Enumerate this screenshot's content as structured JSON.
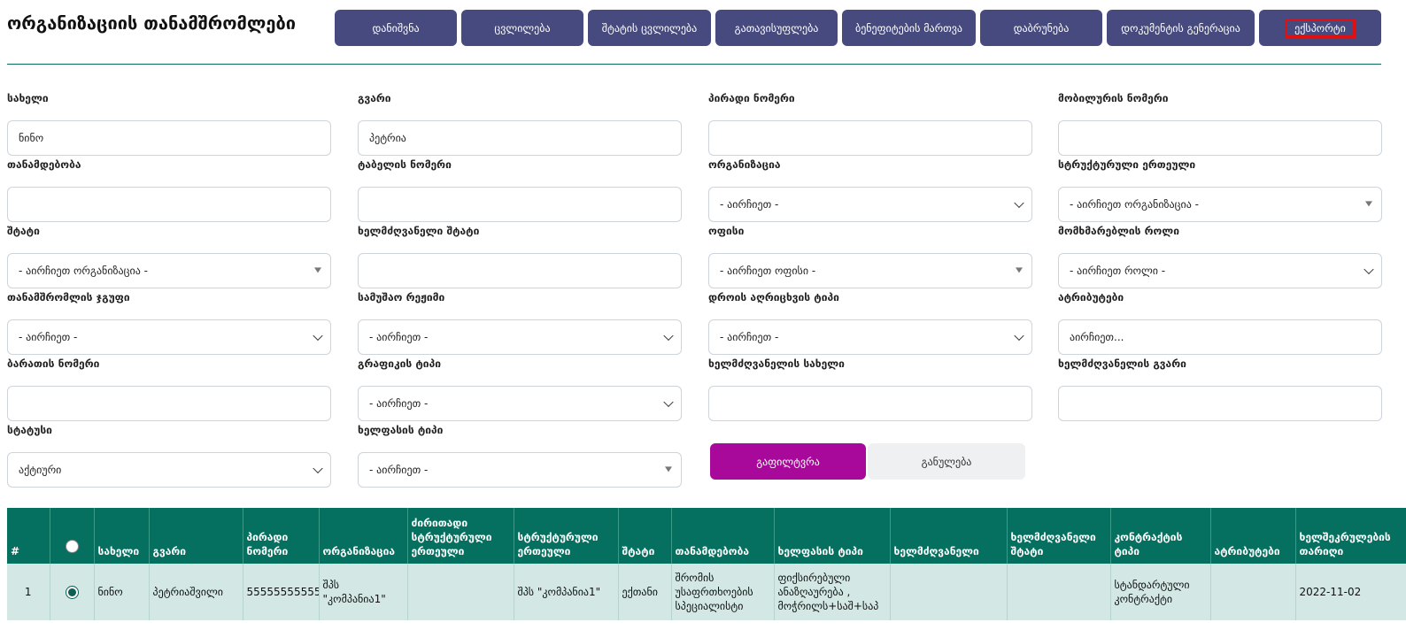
{
  "page": {
    "title": "ორგანიზაციის თანამშრომლები"
  },
  "actions": [
    {
      "label": "დანიშვნა"
    },
    {
      "label": "ცვლილება"
    },
    {
      "label": "შტატის ცვლილება"
    },
    {
      "label": "გათავისუფლება"
    },
    {
      "label": "ბენეფიტების მართვა"
    },
    {
      "label": "დაბრუნება"
    },
    {
      "label": "დოკუმენტის გენერაცია"
    },
    {
      "label": "ექსპორტი"
    }
  ],
  "filters": {
    "first_name": {
      "label": "სახელი",
      "value": "ნინო"
    },
    "last_name": {
      "label": "გვარი",
      "value": "პეტრია"
    },
    "personal_number": {
      "label": "პირადი ნომერი",
      "value": ""
    },
    "mobile_number": {
      "label": "მობილურის ნომერი",
      "value": ""
    },
    "position": {
      "label": "თანამდებობა",
      "value": ""
    },
    "table_number": {
      "label": "ტაბელის ნომერი",
      "value": ""
    },
    "organization": {
      "label": "ორგანიზაცია",
      "value": "- აირჩიეთ -"
    },
    "structural_unit": {
      "label": "სტრუქტურული ერთეული",
      "value": "- აირჩიეთ ორგანიზაცია -"
    },
    "staff": {
      "label": "შტატი",
      "value": "- აირჩიეთ ორგანიზაცია -"
    },
    "manager_staff": {
      "label": "ხელმძღვანელი შტატი",
      "value": ""
    },
    "office": {
      "label": "ოფისი",
      "value": "- აირჩიეთ ოფისი -"
    },
    "user_role": {
      "label": "მომხმარებლის როლი",
      "value": "- აირჩიეთ როლი -"
    },
    "employee_group": {
      "label": "თანამშრომლის ჯგუფი",
      "value": "- აირჩიეთ -"
    },
    "work_mode": {
      "label": "სამუშაო რეჟიმი",
      "value": "- აირჩიეთ -"
    },
    "time_tracking_type": {
      "label": "დროის აღრიცხვის ტიპი",
      "value": "- აირჩიეთ -"
    },
    "attributes": {
      "label": "ატრიბუტები",
      "value": "აირჩიეთ..."
    },
    "card_number": {
      "label": "ბარათის ნომერი",
      "value": ""
    },
    "schedule_type": {
      "label": "გრაფიკის ტიპი",
      "value": "- აირჩიეთ -"
    },
    "manager_first_name": {
      "label": "ხელმძღვანელის სახელი",
      "value": ""
    },
    "manager_last_name": {
      "label": "ხელმძღვანელის გვარი",
      "value": ""
    },
    "status": {
      "label": "სტატუსი",
      "value": "აქტიური"
    },
    "salary_type": {
      "label": "ხელფასის ტიპი",
      "value": "- აირჩიეთ -"
    }
  },
  "buttons": {
    "filter": "გაფილტვრა",
    "reset": "განულება"
  },
  "table": {
    "headers": {
      "num": "#",
      "first_name": "სახელი",
      "last_name": "გვარი",
      "personal_number": "პირადი ნომერი",
      "organization": "ორგანიზაცია",
      "main_structural_unit": "ძირითადი სტრუქტურული ერთეული",
      "structural_unit": "სტრუქტურული ერთეული",
      "staff": "შტატი",
      "position": "თანამდებობა",
      "salary_type": "ხელფასის ტიპი",
      "manager": "ხელმძღვანელი",
      "manager_staff": "ხელმძღვანელი შტატი",
      "contract_type": "კონტრაქტის ტიპი",
      "attributes": "ატრიბუტები",
      "contract_date": "ხელშეკრულების თარიღი"
    },
    "rows": [
      {
        "num": "1",
        "selected": true,
        "first_name": "ნინო",
        "last_name": "პეტრიაშვილი",
        "personal_number": "55555555555",
        "organization": "შპს \"კომპანია1\"",
        "main_structural_unit": "",
        "structural_unit": "შპს \"კომპანია1\"",
        "staff": "ექთანი",
        "position": "შრომის უსაფრთხოების სპეციალისტი",
        "salary_type": "ფიქსირებული ანაზღაურება , მოჭრილს+საშ+საპ",
        "manager": "",
        "manager_staff": "",
        "contract_type": "სტანდარტული კონტრაქტი",
        "attributes": "",
        "contract_date": "2022-11-02"
      }
    ]
  }
}
